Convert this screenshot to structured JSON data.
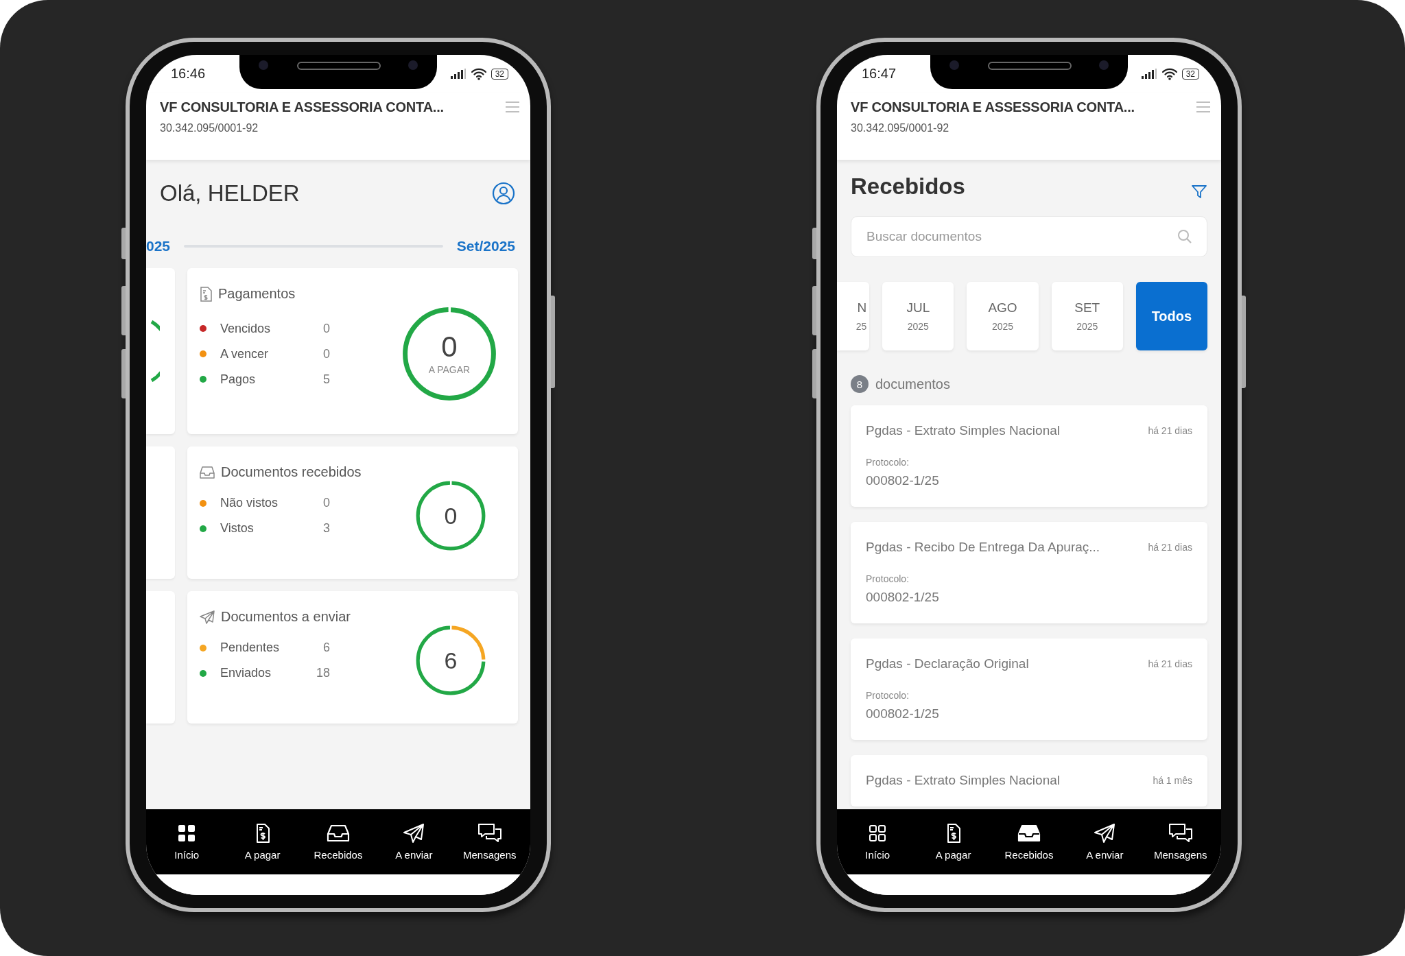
{
  "phones": [
    {
      "kind": "dashboard",
      "status_bar": {
        "time": "16:46",
        "battery": "32"
      },
      "header": {
        "title": "VF CONSULTORIA E ASSESSORIA CONTA...",
        "subtitle": "30.342.095/0001-92"
      },
      "greeting": "Olá, HELDER",
      "period": {
        "previous": "025",
        "current": "Set/2025"
      },
      "cards": [
        {
          "title": "Pagamentos",
          "items": [
            {
              "label": "Vencidos",
              "value": "0",
              "color": "#c62828"
            },
            {
              "label": "A vencer",
              "value": "0",
              "color": "#f29111"
            },
            {
              "label": "Pagos",
              "value": "5",
              "color": "#22a846"
            }
          ],
          "ring": {
            "value": "0",
            "caption": "A PAGAR"
          }
        },
        {
          "title": "Documentos recebidos",
          "items": [
            {
              "label": "Não vistos",
              "value": "0",
              "color": "#f29111"
            },
            {
              "label": "Vistos",
              "value": "3",
              "color": "#22a846"
            }
          ],
          "ring": {
            "value": "0"
          }
        },
        {
          "title": "Documentos a enviar",
          "items": [
            {
              "label": "Pendentes",
              "value": "6",
              "color": "#f5a623"
            },
            {
              "label": "Enviados",
              "value": "18",
              "color": "#22a846"
            }
          ],
          "ring": {
            "value": "6"
          }
        }
      ],
      "nav": [
        {
          "label": "Início",
          "selected": true
        },
        {
          "label": "A pagar",
          "selected": false
        },
        {
          "label": "Recebidos",
          "selected": false
        },
        {
          "label": "A enviar",
          "selected": false
        },
        {
          "label": "Mensagens",
          "selected": false
        }
      ]
    },
    {
      "kind": "documents",
      "status_bar": {
        "time": "16:47",
        "battery": "32"
      },
      "header": {
        "title": "VF CONSULTORIA E ASSESSORIA CONTA...",
        "subtitle": "30.342.095/0001-92"
      },
      "page_title": "Recebidos",
      "search": {
        "placeholder": "Buscar documentos"
      },
      "months": [
        {
          "month": "N",
          "year": "25",
          "selected": false
        },
        {
          "month": "JUL",
          "year": "2025",
          "selected": false
        },
        {
          "month": "AGO",
          "year": "2025",
          "selected": false
        },
        {
          "month": "SET",
          "year": "2025",
          "selected": false
        },
        {
          "month": "Todos",
          "selected": true
        }
      ],
      "count": "8",
      "count_label": "documentos",
      "documents": [
        {
          "title": "Pgdas - Extrato Simples Nacional",
          "time": "há 21 dias",
          "protocol_label": "Protocolo:",
          "protocol": "000802-1/25"
        },
        {
          "title": "Pgdas - Recibo De Entrega Da Apuraç...",
          "time": "há 21 dias",
          "protocol_label": "Protocolo:",
          "protocol": "000802-1/25"
        },
        {
          "title": "Pgdas - Declaração Original",
          "time": "há 21 dias",
          "protocol_label": "Protocolo:",
          "protocol": "000802-1/25"
        },
        {
          "title": "Pgdas - Extrato Simples Nacional",
          "time": "há 1 mês"
        }
      ],
      "nav": [
        {
          "label": "Início",
          "selected": false
        },
        {
          "label": "A pagar",
          "selected": false
        },
        {
          "label": "Recebidos",
          "selected": true
        },
        {
          "label": "A enviar",
          "selected": false
        },
        {
          "label": "Mensagens",
          "selected": false
        }
      ]
    }
  ]
}
